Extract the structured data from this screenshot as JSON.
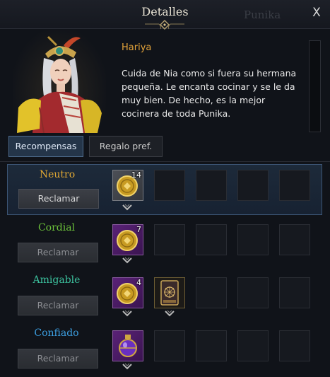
{
  "window": {
    "title": "Detalles",
    "background_title": "Punika",
    "close_label": "X"
  },
  "npc": {
    "name": "Hariya",
    "description": "Cuida de Nia como si fuera su hermana pequeña. Le encanta cocinar y se le da muy bien. De hecho, es la mejor cocinera de toda Punika."
  },
  "tabs": [
    {
      "label": "Recompensas",
      "active": true
    },
    {
      "label": "Regalo pref.",
      "active": false
    }
  ],
  "rewards": [
    {
      "level": "Neutro",
      "level_color": "#e0a833",
      "claim_label": "Reclamar",
      "claim_enabled": true,
      "items": [
        {
          "icon": "gold-coin-icon",
          "count": "14"
        }
      ]
    },
    {
      "level": "Cordial",
      "level_color": "#6cc23a",
      "claim_label": "Reclamar",
      "claim_enabled": false,
      "items": [
        {
          "icon": "gold-coin-icon",
          "count": "7"
        }
      ]
    },
    {
      "level": "Amigable",
      "level_color": "#3cc39f",
      "claim_label": "Reclamar",
      "claim_enabled": false,
      "items": [
        {
          "icon": "gold-coin-icon",
          "count": "4"
        },
        {
          "icon": "card-icon",
          "count": ""
        }
      ]
    },
    {
      "level": "Confiado",
      "level_color": "#3c9ee0",
      "claim_label": "Reclamar",
      "claim_enabled": false,
      "items": [
        {
          "icon": "potion-icon",
          "count": ""
        }
      ]
    }
  ],
  "colors": {
    "accent_gold": "#e3a33a",
    "active_tab": "#243549",
    "active_row_border": "#3c5575"
  }
}
